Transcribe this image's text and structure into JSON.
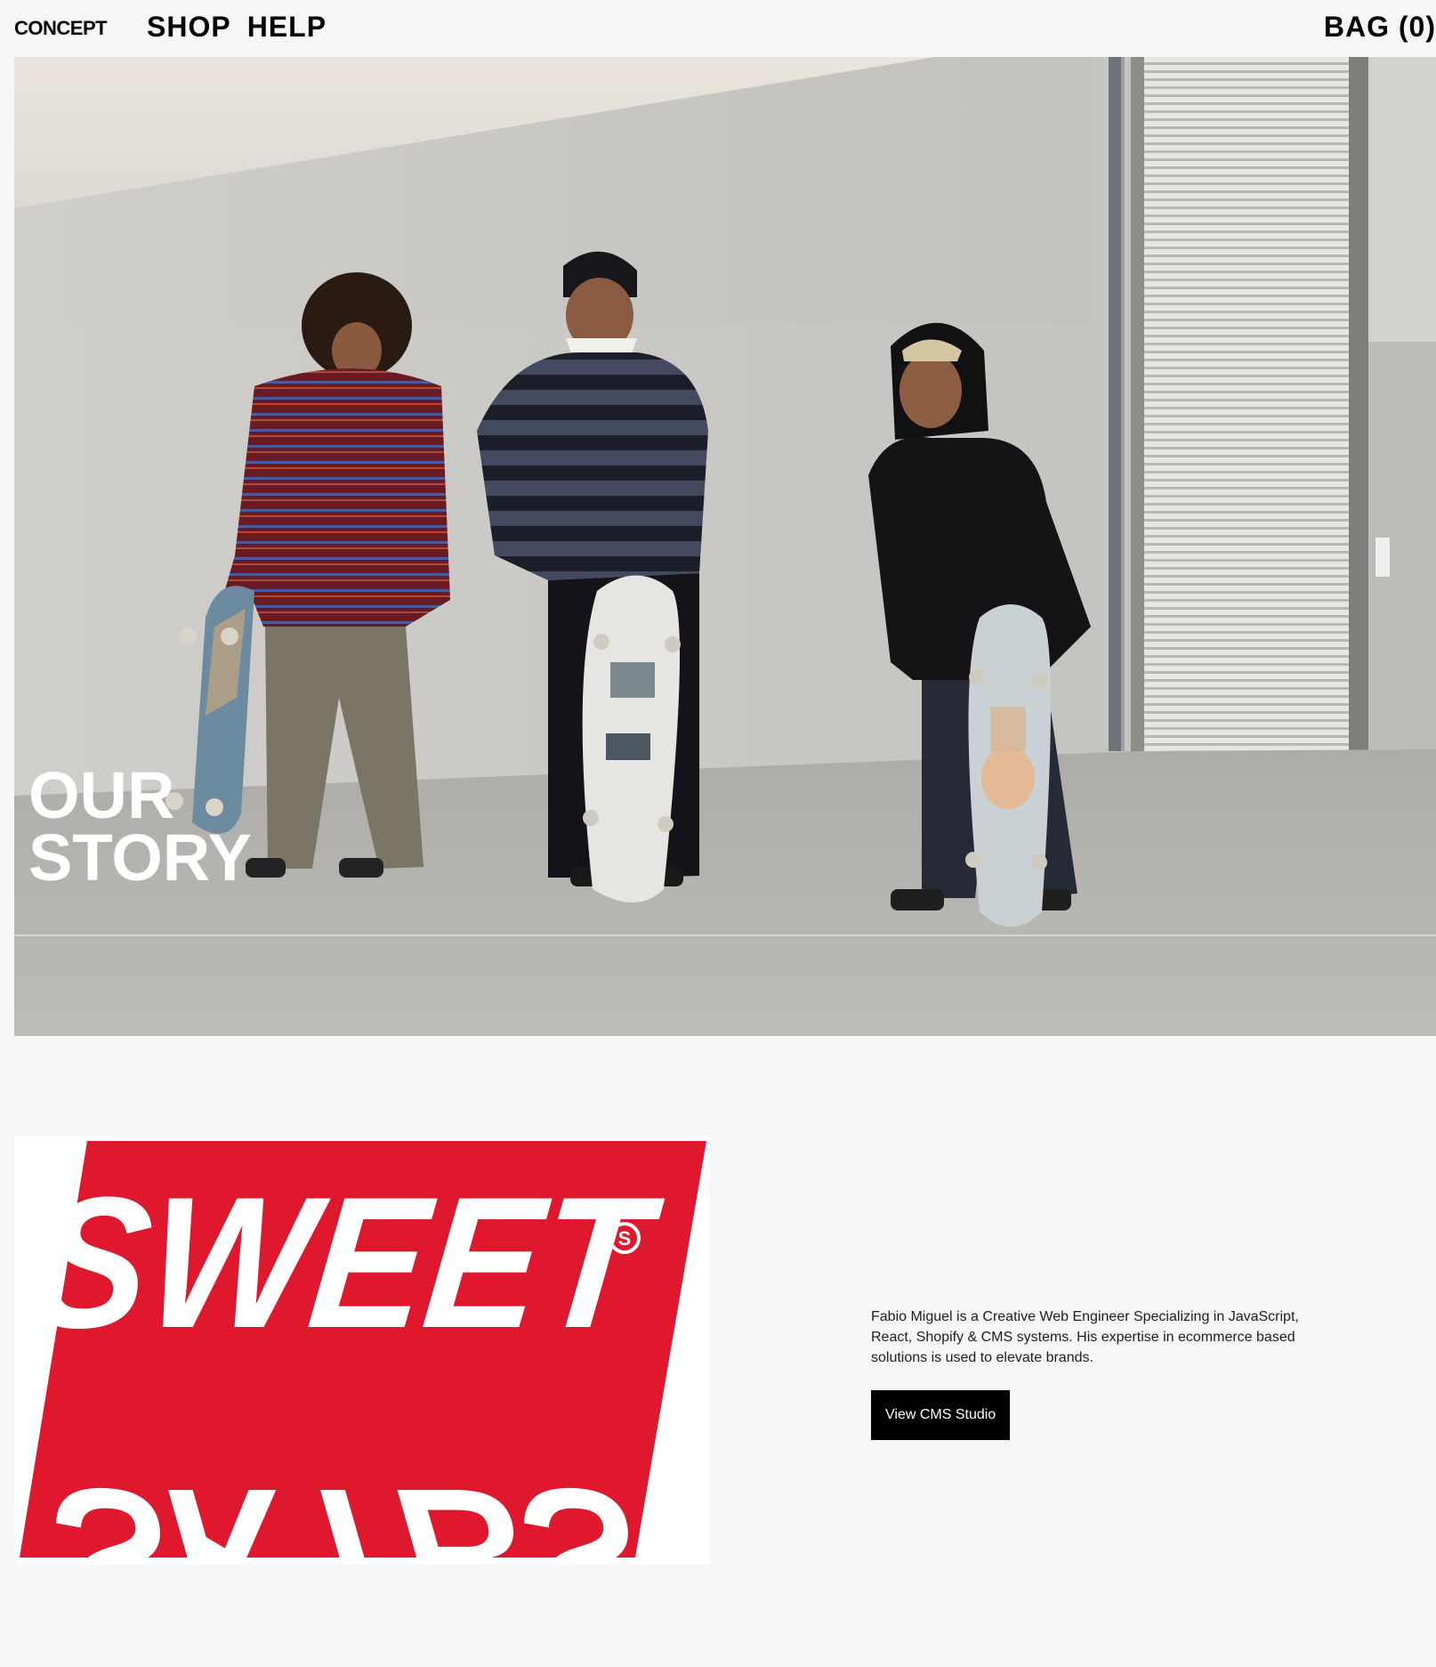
{
  "header": {
    "logo": "CONCEPT",
    "nav": [
      "SHOP",
      "HELP"
    ],
    "bag_label": "BAG (0)"
  },
  "hero": {
    "title_line1": "OUR",
    "title_line2": "STORY"
  },
  "story": {
    "logo_top": "SWEET",
    "logo_bottom": "SKTBS",
    "logo_mark": "S",
    "description": "Fabio Miguel is a Creative Web Engineer Specializing in JavaScript, React, Shopify & CMS systems. His expertise in ecommerce based solutions is used to elevate brands.",
    "cta_label": "View CMS Studio"
  },
  "colors": {
    "background": "#f7f6f4",
    "brand_red": "#e0182d",
    "button_bg": "#000000"
  }
}
